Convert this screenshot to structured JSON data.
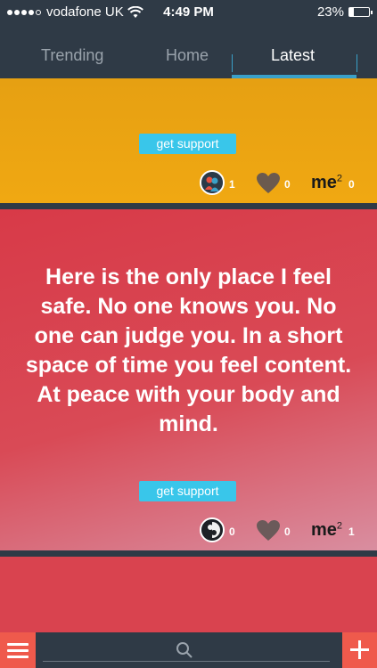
{
  "status": {
    "carrier": "vodafone UK",
    "time": "4:49 PM",
    "battery": "23%",
    "battery_level": 0.23,
    "signal_bars": 4
  },
  "tabs": [
    {
      "label": "Trending",
      "active": false
    },
    {
      "label": "Home",
      "active": false
    },
    {
      "label": "Latest",
      "active": true
    }
  ],
  "posts": [
    {
      "text": "",
      "support_label": "get support",
      "avatar_count": "1",
      "heart_count": "0",
      "me2_label": "me",
      "me2_sup": "2",
      "me2_count": "0"
    },
    {
      "text": "Here is the only place I feel safe. No one knows you. No one can judge you. In a short space of time you feel content. At peace with your body and mind.",
      "support_label": "get support",
      "avatar_count": "0",
      "heart_count": "0",
      "me2_label": "me",
      "me2_sup": "2",
      "me2_count": "1"
    }
  ],
  "colors": {
    "header_bg": "#2f3a46",
    "card_orange": "#f0a812",
    "card_red": "#d9434f",
    "support_button": "#39c6ea",
    "accent_red": "#ef5a4c",
    "tab_indicator": "#3aa0c8"
  },
  "icons": {
    "menu": "hamburger-icon",
    "search": "search-icon",
    "add": "plus-icon",
    "like": "heart-icon",
    "wifi": "wifi-icon"
  }
}
